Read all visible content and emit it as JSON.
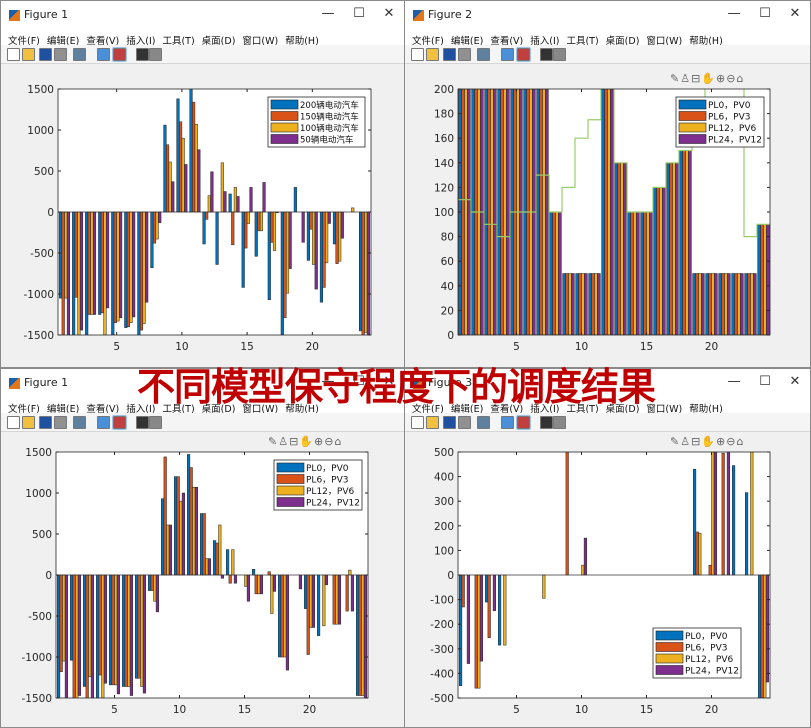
{
  "overlay_title": "不同模型保守程度下的调度结果",
  "menu": [
    "文件(F)",
    "编辑(E)",
    "查看(V)",
    "插入(I)",
    "工具(T)",
    "桌面(D)",
    "窗口(W)",
    "帮助(H)"
  ],
  "toolbar_icons": [
    "new-file-icon",
    "open-folder-icon",
    "save-icon",
    "print-icon",
    "link-plot-icon",
    "colorbar-icon",
    "legend-icon",
    "pointer-icon",
    "property-inspector-icon"
  ],
  "axes_toolbar_icons": [
    "brush-icon",
    "data-tip-icon",
    "restore-view-icon",
    "pan-icon",
    "zoom-in-icon",
    "zoom-out-icon",
    "home-icon"
  ],
  "window_controls": {
    "minimize": "—",
    "maximize": "☐",
    "close": "✕"
  },
  "colors": {
    "series": [
      "#0072BD",
      "#D95319",
      "#EDB120",
      "#7E2F8E"
    ],
    "step_line": "#9ACD6A",
    "overlay": "#C00000"
  },
  "windows": [
    {
      "title": "Figure 1",
      "axes_toolbar": false,
      "chart_data": {
        "type": "bar",
        "categories": [
          1,
          2,
          3,
          4,
          5,
          6,
          7,
          8,
          9,
          10,
          11,
          12,
          13,
          14,
          15,
          16,
          17,
          18,
          19,
          20,
          21,
          22,
          23,
          24
        ],
        "xlim": [
          0.5,
          24.5
        ],
        "ylim": [
          -1500,
          1500
        ],
        "xticks": [
          5,
          10,
          15,
          20
        ],
        "yticks": [
          -1500,
          -1000,
          -500,
          0,
          500,
          1000,
          1500
        ],
        "legend_position": "top-right",
        "series": [
          {
            "name": "200辆电动汽车",
            "values": [
              -1050,
              -1500,
              -1500,
              -1250,
              -1500,
              -1410,
              -1500,
              -680,
              1060,
              1380,
              1500,
              -390,
              -640,
              220,
              -920,
              -540,
              -1070,
              -1500,
              300,
              -590,
              -1100,
              -390,
              0,
              -1450
            ]
          },
          {
            "name": "150辆电动汽车",
            "values": [
              -1500,
              -1040,
              -1250,
              -1230,
              -1350,
              -1400,
              -1440,
              -380,
              820,
              1100,
              1340,
              -90,
              0,
              -400,
              -440,
              -230,
              -370,
              -1290,
              0,
              -210,
              -920,
              -630,
              0,
              -1500
            ]
          },
          {
            "name": "100辆电动汽车",
            "values": [
              -1050,
              -1500,
              -1250,
              -1500,
              -1330,
              -1350,
              -1360,
              -330,
              610,
              900,
              1070,
              200,
              600,
              300,
              -140,
              -230,
              -470,
              -990,
              0,
              -640,
              -620,
              -600,
              50,
              -1470
            ]
          },
          {
            "name": "50辆电动汽车",
            "values": [
              -1500,
              -1440,
              -1250,
              -1170,
              -1290,
              -1280,
              -1100,
              -130,
              370,
              580,
              760,
              490,
              250,
              190,
              300,
              360,
              -10,
              -690,
              -370,
              -940,
              -140,
              -320,
              0,
              -1500
            ]
          }
        ]
      }
    },
    {
      "title": "Figure 2",
      "axes_toolbar": true,
      "chart_data": {
        "type": "bar",
        "categories": [
          1,
          2,
          3,
          4,
          5,
          6,
          7,
          8,
          9,
          10,
          11,
          12,
          13,
          14,
          15,
          16,
          17,
          18,
          19,
          20,
          21,
          22,
          23,
          24
        ],
        "xlim": [
          0.5,
          24.5
        ],
        "ylim": [
          0,
          200
        ],
        "xticks": [
          5,
          10,
          15,
          20
        ],
        "yticks": [
          0,
          20,
          40,
          60,
          80,
          100,
          120,
          140,
          160,
          180,
          200
        ],
        "legend_position": "top-right",
        "series": [
          {
            "name": "PL0，PV0",
            "values": [
              200,
              200,
              200,
              200,
              200,
              200,
              200,
              100,
              50,
              50,
              50,
              200,
              140,
              100,
              100,
              120,
              140,
              150,
              50,
              50,
              50,
              50,
              50,
              90
            ]
          },
          {
            "name": "PL6，PV3",
            "values": [
              200,
              200,
              200,
              200,
              200,
              200,
              200,
              100,
              50,
              50,
              50,
              200,
              140,
              100,
              100,
              120,
              140,
              150,
              50,
              50,
              50,
              50,
              50,
              90
            ]
          },
          {
            "name": "PL12，PV6",
            "values": [
              200,
              200,
              200,
              200,
              200,
              200,
              200,
              100,
              50,
              50,
              50,
              200,
              140,
              100,
              100,
              120,
              140,
              150,
              50,
              50,
              50,
              50,
              50,
              90
            ]
          },
          {
            "name": "PL24，PV12",
            "values": [
              200,
              200,
              200,
              200,
              200,
              200,
              200,
              100,
              50,
              50,
              50,
              200,
              140,
              100,
              100,
              120,
              140,
              150,
              50,
              50,
              50,
              50,
              50,
              90
            ]
          }
        ],
        "step_line": [
          110,
          100,
          90,
          80,
          100,
          100,
          130,
          100,
          120,
          160,
          175,
          210,
          140,
          100,
          100,
          120,
          140,
          150,
          160,
          210,
          210,
          210,
          80,
          90
        ]
      }
    },
    {
      "title": "Figure 1",
      "axes_toolbar": true,
      "chart_data": {
        "type": "bar",
        "categories": [
          1,
          2,
          3,
          4,
          5,
          6,
          7,
          8,
          9,
          10,
          11,
          12,
          13,
          14,
          15,
          16,
          17,
          18,
          19,
          20,
          21,
          22,
          23,
          24
        ],
        "xlim": [
          0.5,
          24.5
        ],
        "ylim": [
          -1500,
          1500
        ],
        "xticks": [
          5,
          10,
          15,
          20
        ],
        "yticks": [
          -1500,
          -1000,
          -500,
          0,
          500,
          1000,
          1500
        ],
        "legend_position": "top-right",
        "series": [
          {
            "name": "PL0，PV0",
            "values": [
              -1500,
              -1040,
              -1360,
              -1500,
              -1340,
              -1360,
              -1260,
              -190,
              930,
              1200,
              1470,
              750,
              420,
              310,
              0,
              70,
              0,
              -1000,
              0,
              -410,
              -740,
              0,
              0,
              -1470
            ]
          },
          {
            "name": "PL6，PV3",
            "values": [
              -1180,
              -1500,
              -1500,
              -1220,
              -1340,
              -1360,
              -1260,
              -190,
              1440,
              1200,
              1310,
              750,
              390,
              -100,
              0,
              -230,
              40,
              -1000,
              0,
              -970,
              0,
              -600,
              -440,
              -1470
            ]
          },
          {
            "name": "PL12，PV6",
            "values": [
              -1050,
              -1500,
              -1240,
              -1500,
              -1340,
              -1360,
              -1360,
              -320,
              610,
              900,
              1070,
              200,
              610,
              310,
              -140,
              -230,
              -470,
              -1000,
              0,
              -640,
              -620,
              -600,
              60,
              -1470
            ]
          },
          {
            "name": "PL24，PV12",
            "values": [
              -1500,
              -1470,
              -1500,
              -1320,
              -1450,
              -1470,
              -1440,
              -450,
              610,
              1000,
              1070,
              200,
              -40,
              -100,
              -320,
              -230,
              -200,
              -1160,
              -170,
              -640,
              -120,
              -600,
              -440,
              -1500
            ]
          }
        ]
      }
    },
    {
      "title": "Figure 3",
      "axes_toolbar": true,
      "chart_data": {
        "type": "bar",
        "categories": [
          1,
          2,
          3,
          4,
          5,
          6,
          7,
          8,
          9,
          10,
          11,
          12,
          13,
          14,
          15,
          16,
          17,
          18,
          19,
          20,
          21,
          22,
          23,
          24
        ],
        "xlim": [
          0.5,
          24.5
        ],
        "ylim": [
          -500,
          500
        ],
        "xticks": [
          5,
          10,
          15,
          20
        ],
        "yticks": [
          -500,
          -400,
          -300,
          -200,
          -100,
          0,
          100,
          200,
          300,
          400,
          500
        ],
        "legend_position": "bottom-right",
        "series": [
          {
            "name": "PL0，PV0",
            "values": [
              -450,
              0,
              -110,
              -285,
              0,
              0,
              0,
              0,
              0,
              0,
              0,
              0,
              0,
              0,
              0,
              0,
              0,
              0,
              430,
              0,
              0,
              445,
              335,
              -500
            ]
          },
          {
            "name": "PL6，PV3",
            "values": [
              -130,
              -460,
              -255,
              0,
              0,
              0,
              0,
              0,
              500,
              0,
              0,
              0,
              0,
              0,
              0,
              0,
              0,
              0,
              175,
              40,
              495,
              0,
              0,
              -500
            ]
          },
          {
            "name": "PL12，PV6",
            "values": [
              0,
              -460,
              0,
              -285,
              0,
              0,
              -95,
              0,
              0,
              40,
              0,
              0,
              0,
              0,
              0,
              0,
              0,
              0,
              170,
              500,
              0,
              0,
              500,
              -500
            ]
          },
          {
            "name": "PL24，PV12",
            "values": [
              -360,
              -350,
              -145,
              0,
              0,
              0,
              0,
              0,
              0,
              150,
              0,
              0,
              0,
              0,
              0,
              0,
              0,
              0,
              0,
              500,
              500,
              0,
              0,
              -435
            ]
          }
        ]
      }
    }
  ]
}
